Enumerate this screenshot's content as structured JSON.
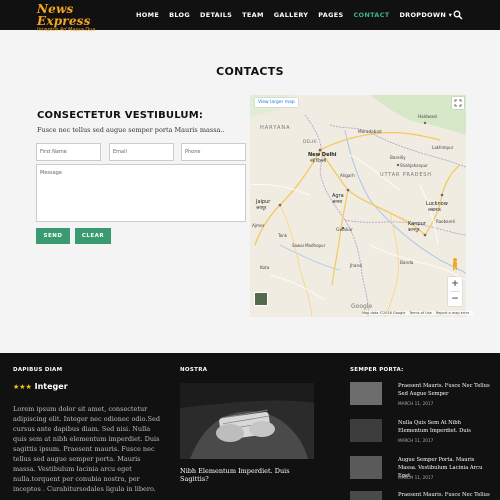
{
  "brand": {
    "title": "News Express",
    "tagline": "Inceptos Ad Massa Dua"
  },
  "nav": {
    "items": [
      "HOME",
      "BLOG",
      "DETAILS",
      "TEAM",
      "GALLERY",
      "PAGES",
      "CONTACT",
      "DROPDOWN ▾"
    ],
    "active_index": 6,
    "search_icon": "search-icon",
    "accent": "#3cb48a"
  },
  "contacts": {
    "title": "CONTACTS",
    "heading": "CONSECTETUR VESTIBULUM:",
    "description": "Fusce nec tellus sed augue semper porta Mauris massa..",
    "first_name_placeholder": "First Name",
    "email_placeholder": "Email",
    "phone_placeholder": "Phone",
    "message_placeholder": "Message",
    "send_label": "SEND",
    "clear_label": "CLEAR",
    "button_color": "#3a9b73"
  },
  "map": {
    "view_larger": "View larger map",
    "labels": {
      "haryana": "HARYANA",
      "uttar_pradesh": "UTTAR PRADESH",
      "delhi": "DELHI",
      "new_delhi": "New Delhi",
      "new_delhi_hi": "नई दिल्ली",
      "agra": "Agra",
      "agra_hi": "आगरा",
      "jaipur": "Jaipur",
      "jaipur_hi": "जयपुर",
      "lucknow": "Lucknow",
      "lucknow_hi": "लखनऊ",
      "kanpur": "Kanpur",
      "kanpur_hi": "कानपुर",
      "gwalior": "Gwalior",
      "haldwani": "Haldwani",
      "bareilly": "Bareilly",
      "shahjahanpur": "Shahjahanpur",
      "moradabad": "Moradabad",
      "aligarh": "Aligarh",
      "jhansi": "Jhansi",
      "kota": "Kota",
      "ajmer": "Ajmer",
      "lakhimpur": "Lakhimpur",
      "sawai_madhopur": "Sawai Madhopur",
      "tonk": "Tonk",
      "raebareli": "Raebareli",
      "banda": "Banda"
    },
    "google": "Google",
    "map_data": "Map data ©2016 Google",
    "terms": "Terms of Use",
    "report": "Report a map error",
    "zoom_in": "+",
    "zoom_out": "−"
  },
  "footer": {
    "col1": {
      "title": "DAPIBUS DIAM",
      "stars": "★★★",
      "heading": "Integer",
      "text": "Lorem ipsum dolor sit amet, consectetur adipiscing elit. Integer nec odionec odio.Sed cursus ante dapibus diam. Sed nisi. Nulla quis sem at nibh elementum imperdiet. Duis sagittis ipsum. Praesent mauris. Fusce nec tellus sed augue semper porta. Mauris massa. Vestibulum lacinia arcu eget nulla.torquent per conubia nostra, per inceptos . Curabitursodales ligula in libero."
    },
    "col2": {
      "title": "NOSTRA",
      "caption": "Nibh Elementum Imperdiet. Duis Sagittis?"
    },
    "col3": {
      "title": "SEMPER PORTA:",
      "items": [
        {
          "title": "Praesent Mauris. Fusce Nec Tellus Sed Augue Semper",
          "date": "MARCH 11, 2017"
        },
        {
          "title": "Nulla Quis Sem At Nibh Elementum Imperdiet. Duis",
          "date": "MARCH 11, 2017"
        },
        {
          "title": "Augue Semper Porta. Mauris Massa. Vestibulum Lacinia Arcu Eget.",
          "date": "MARCH 11, 2017"
        },
        {
          "title": "Praesent Mauris. Fusce Nec Tellus",
          "date": ""
        }
      ]
    }
  }
}
